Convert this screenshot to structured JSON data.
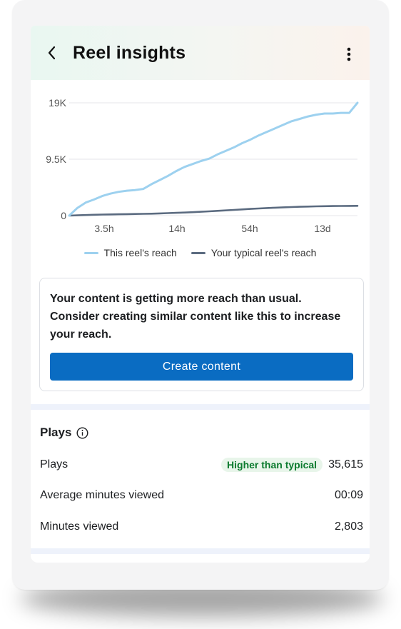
{
  "header": {
    "title": "Reel insights",
    "back_icon": "chevron-left-icon",
    "more_icon": "vertical-ellipsis-icon"
  },
  "chart_data": {
    "type": "line",
    "x_ticks": [
      "3.5h",
      "14h",
      "54h",
      "13d"
    ],
    "y_ticks": [
      "19K",
      "9.5K",
      "0"
    ],
    "ylim": [
      0,
      19000
    ],
    "grid": true,
    "legend_position": "bottom",
    "series": [
      {
        "name": "This reel's reach",
        "color": "#9dd1ef",
        "values": [
          0,
          1300,
          2200,
          2700,
          3300,
          3700,
          4000,
          4200,
          4300,
          4500,
          5300,
          6000,
          6700,
          7500,
          8200,
          8700,
          9200,
          9600,
          10300,
          10900,
          11500,
          12200,
          12800,
          13500,
          14100,
          14700,
          15300,
          15900,
          16300,
          16700,
          17000,
          17200,
          17200,
          17300,
          17300,
          19000
        ]
      },
      {
        "name": "Your typical reel's reach",
        "color": "#5b6b80",
        "values": [
          0,
          50,
          100,
          150,
          180,
          200,
          230,
          250,
          280,
          300,
          330,
          370,
          420,
          470,
          520,
          580,
          650,
          720,
          800,
          880,
          960,
          1050,
          1130,
          1200,
          1270,
          1330,
          1390,
          1440,
          1490,
          1530,
          1560,
          1590,
          1610,
          1620,
          1640,
          1650
        ]
      }
    ]
  },
  "card": {
    "message": "Your content is getting more reach than usual. Consider creating similar content like this to increase your reach.",
    "button_label": "Create content"
  },
  "plays_section": {
    "title": "Plays",
    "info_icon": "info-icon",
    "rows": [
      {
        "label": "Plays",
        "badge": "Higher than typical",
        "value": "35,615"
      },
      {
        "label": "Average minutes viewed",
        "value": "00:09"
      },
      {
        "label": "Minutes viewed",
        "value": "2,803"
      }
    ]
  },
  "colors": {
    "accent": "#0a6cc2",
    "badge_bg": "#e8f5ea",
    "badge_text": "#0b7a2e"
  }
}
